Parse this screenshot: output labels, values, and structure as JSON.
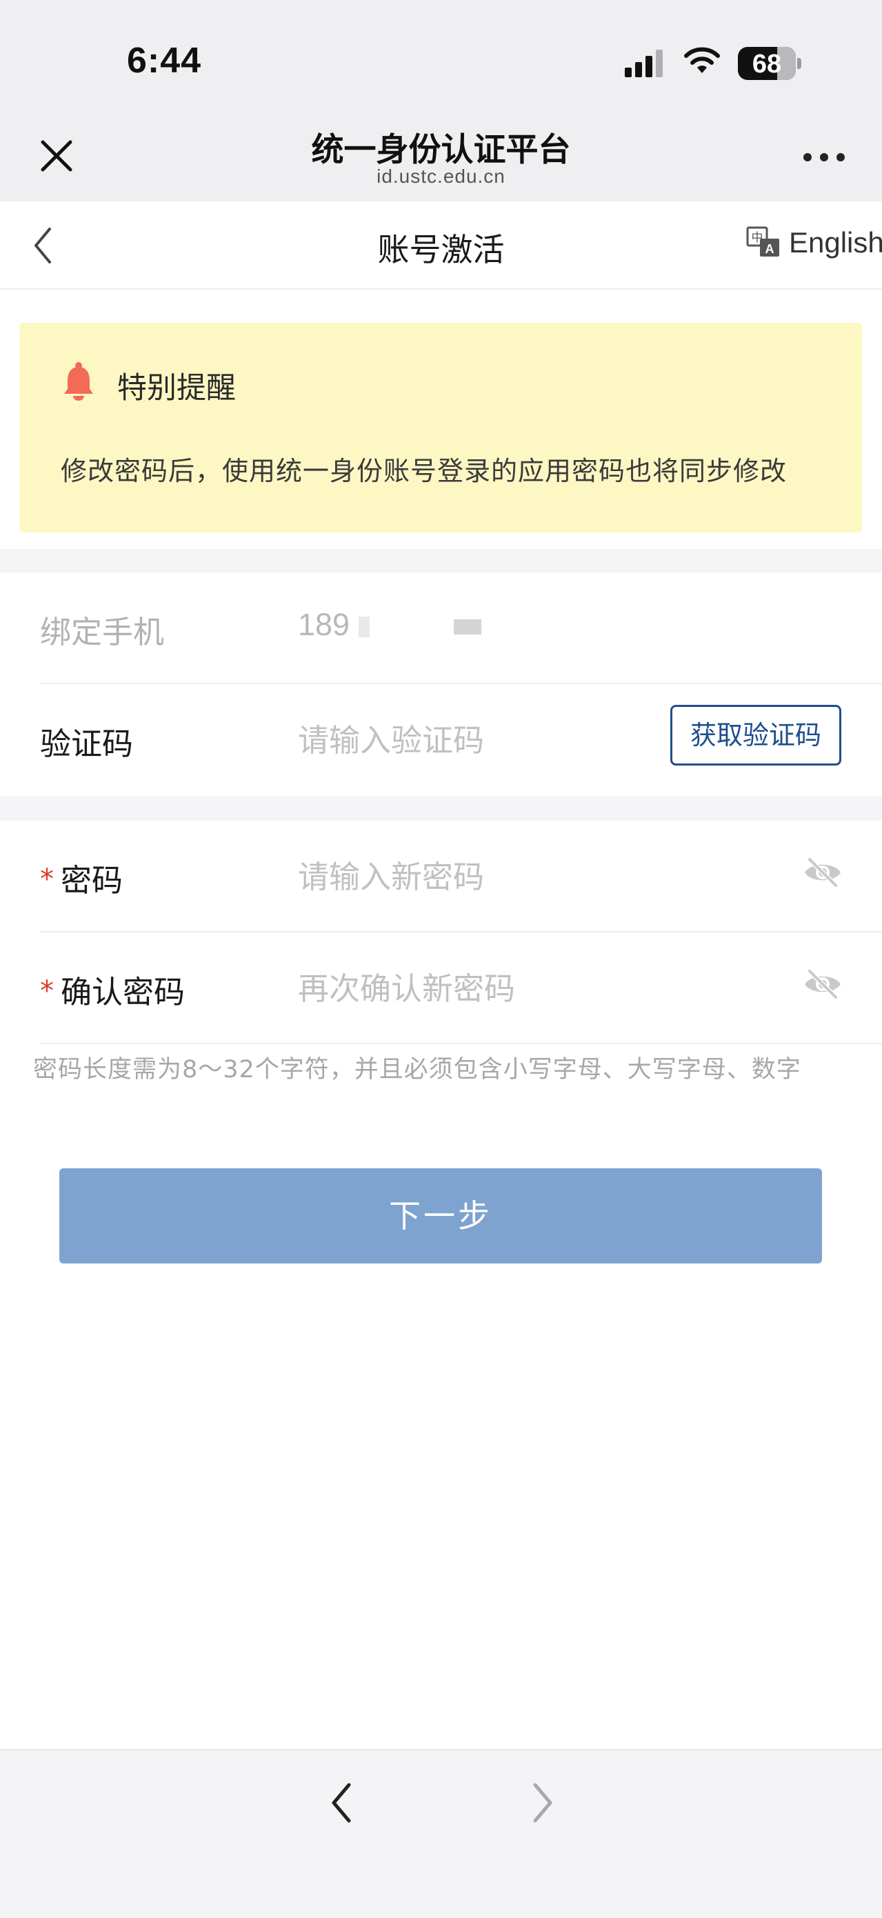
{
  "status_bar": {
    "time": "6:44",
    "battery_level": "68",
    "icons": [
      "cellular-signal-icon",
      "wifi-icon",
      "battery-icon"
    ]
  },
  "browser": {
    "title": "统一身份认证平台",
    "url": "id.ustc.edu.cn",
    "close_icon": "close-icon",
    "more_icon": "more-icon"
  },
  "header": {
    "title": "账号激活",
    "language_label": "English",
    "back_icon": "chevron-left-icon",
    "language_icon": "translate-icon"
  },
  "notice": {
    "title": "特别提醒",
    "text": "修改密码后，使用统一身份账号登录的应用密码也将同步修改",
    "icon": "bell-icon",
    "background": "#fdf7c4",
    "icon_color": "#f26b57"
  },
  "form": {
    "phone": {
      "label": "绑定手机",
      "value": "189"
    },
    "code": {
      "label": "验证码",
      "placeholder": "请输入验证码",
      "button_label": "获取验证码"
    },
    "password": {
      "required_mark": "*",
      "label": "密码",
      "placeholder": "请输入新密码"
    },
    "confirm": {
      "required_mark": "*",
      "label": "确认密码",
      "placeholder": "再次确认新密码"
    },
    "hint": "密码长度需为8～32个字符，并且必须包含小写字母、大写字母、数字",
    "next_button": "下一步"
  },
  "colors": {
    "accent": "#1f4e8c",
    "primary_button": "#7fa3cf",
    "required": "#e0392b"
  },
  "toolbar": {
    "back_icon": "chevron-left-icon",
    "forward_icon": "chevron-right-icon"
  }
}
